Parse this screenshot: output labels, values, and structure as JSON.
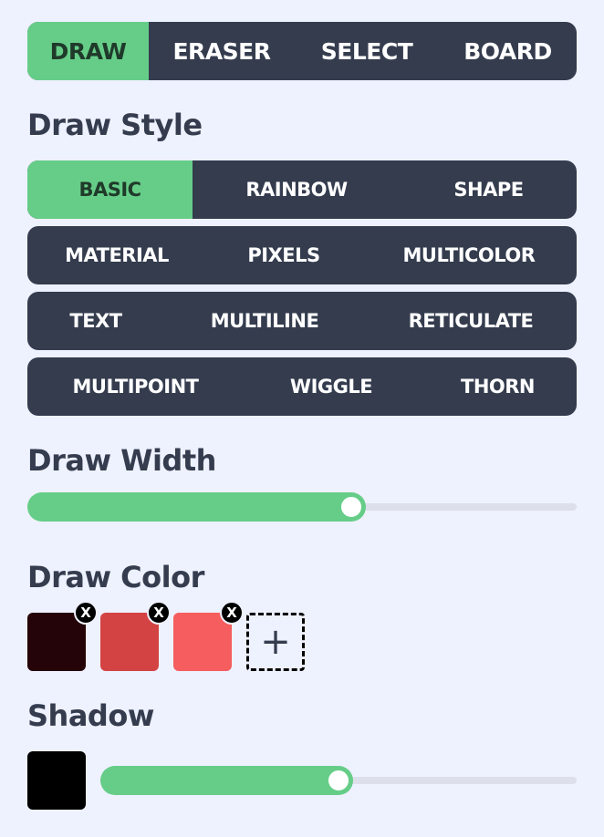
{
  "tool_tabs": [
    {
      "label": "DRAW",
      "active": true
    },
    {
      "label": "ERASER",
      "active": false
    },
    {
      "label": "SELECT",
      "active": false
    },
    {
      "label": "BOARD",
      "active": false
    }
  ],
  "draw_style": {
    "heading": "Draw Style",
    "rows": [
      [
        {
          "label": "BASIC",
          "active": true
        },
        {
          "label": "RAINBOW",
          "active": false
        },
        {
          "label": "SHAPE",
          "active": false
        }
      ],
      [
        {
          "label": "MATERIAL",
          "active": false
        },
        {
          "label": "PIXELS",
          "active": false
        },
        {
          "label": "MULTICOLOR",
          "active": false
        }
      ],
      [
        {
          "label": "TEXT",
          "active": false
        },
        {
          "label": "MULTILINE",
          "active": false
        },
        {
          "label": "RETICULATE",
          "active": false
        }
      ],
      [
        {
          "label": "MULTIPOINT",
          "active": false
        },
        {
          "label": "WIGGLE",
          "active": false
        },
        {
          "label": "THORN",
          "active": false
        }
      ]
    ]
  },
  "draw_width": {
    "heading": "Draw Width",
    "value_fraction": 0.59
  },
  "draw_color": {
    "heading": "Draw Color",
    "swatches": [
      "#240408",
      "#d34343",
      "#f55d5e"
    ],
    "remove_label": "X",
    "add_label": "+",
    "remove_icon": "close-icon",
    "add_icon": "plus-icon"
  },
  "shadow": {
    "heading": "Shadow",
    "color": "#000000",
    "value_fraction": 0.5
  },
  "colors": {
    "accent": "#66cd88",
    "panel": "#343c4e",
    "background": "#eef1fe"
  }
}
